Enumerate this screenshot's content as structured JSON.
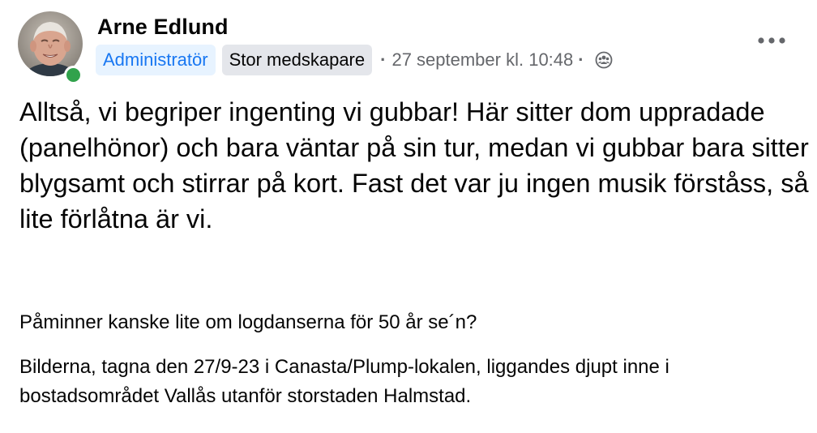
{
  "post": {
    "author": {
      "name": "Arne Edlund",
      "online": true,
      "status_color": "#31a24c"
    },
    "badges": {
      "role": "Administratör",
      "contributor": "Stor medskapare"
    },
    "timestamp": "27 september kl. 10:48",
    "separator": "·",
    "audience_icon": "group-audience-icon",
    "more_icon": "more-horizontal-icon",
    "paragraphs": {
      "main": "Alltså, vi begriper ingenting vi gubbar! Här sitter dom uppradade (panelhönor) och bara väntar på sin tur, medan vi gubbar bara sitter blygsamt och stirrar på kort. Fast det var ju ingen musik förståss, så lite förlåtna är vi.",
      "second": "Påminner kanske lite om logdanserna för 50 år se´n?",
      "third": "Bilderna, tagna den 27/9-23 i Canasta/Plump-lokalen, liggandes djupt inne i bostadsområdet Vallås utanför storstaden Halmstad."
    },
    "colors": {
      "accent": "#1877f2",
      "admin_badge_bg": "#e7f3ff",
      "badge_bg": "#e4e6eb",
      "secondary_text": "#65676b"
    }
  }
}
